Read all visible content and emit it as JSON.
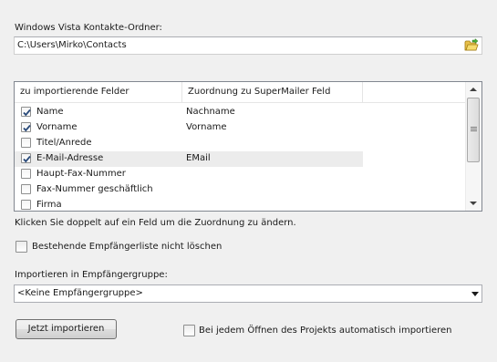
{
  "folder": {
    "label": "Windows Vista Kontakte-Ordner:",
    "path": "C:\\Users\\Mirko\\Contacts",
    "browse_icon": "folder-open-icon"
  },
  "fields_list": {
    "columns": [
      "zu importierende Felder",
      "Zuordnung zu SuperMailer Feld"
    ],
    "rows": [
      {
        "field": "Name",
        "mapping": "Nachname",
        "checked": true
      },
      {
        "field": "Vorname",
        "mapping": "Vorname",
        "checked": true
      },
      {
        "field": "Titel/Anrede",
        "mapping": "",
        "checked": false
      },
      {
        "field": "E-Mail-Adresse",
        "mapping": "EMail",
        "checked": true
      },
      {
        "field": "Haupt-Fax-Nummer",
        "mapping": "",
        "checked": false
      },
      {
        "field": "Fax-Nummer geschäftlich",
        "mapping": "",
        "checked": false
      },
      {
        "field": "Firma",
        "mapping": "",
        "checked": false
      }
    ],
    "selected_row": 3
  },
  "hint": "Klicken Sie doppelt auf ein Feld um die Zuordnung zu ändern.",
  "keep_list": {
    "label": "Bestehende Empfängerliste nicht löschen",
    "checked": false
  },
  "group": {
    "label": "Importieren in Empfängergruppe:",
    "selected": "<Keine Empfängergruppe>"
  },
  "import_button": "Jetzt importieren",
  "auto_import": {
    "label": "Bei jedem Öffnen des Projekts automatisch importieren",
    "checked": false
  },
  "colors": {
    "background": "#f0f0f0",
    "check": "#2a4a7a"
  }
}
